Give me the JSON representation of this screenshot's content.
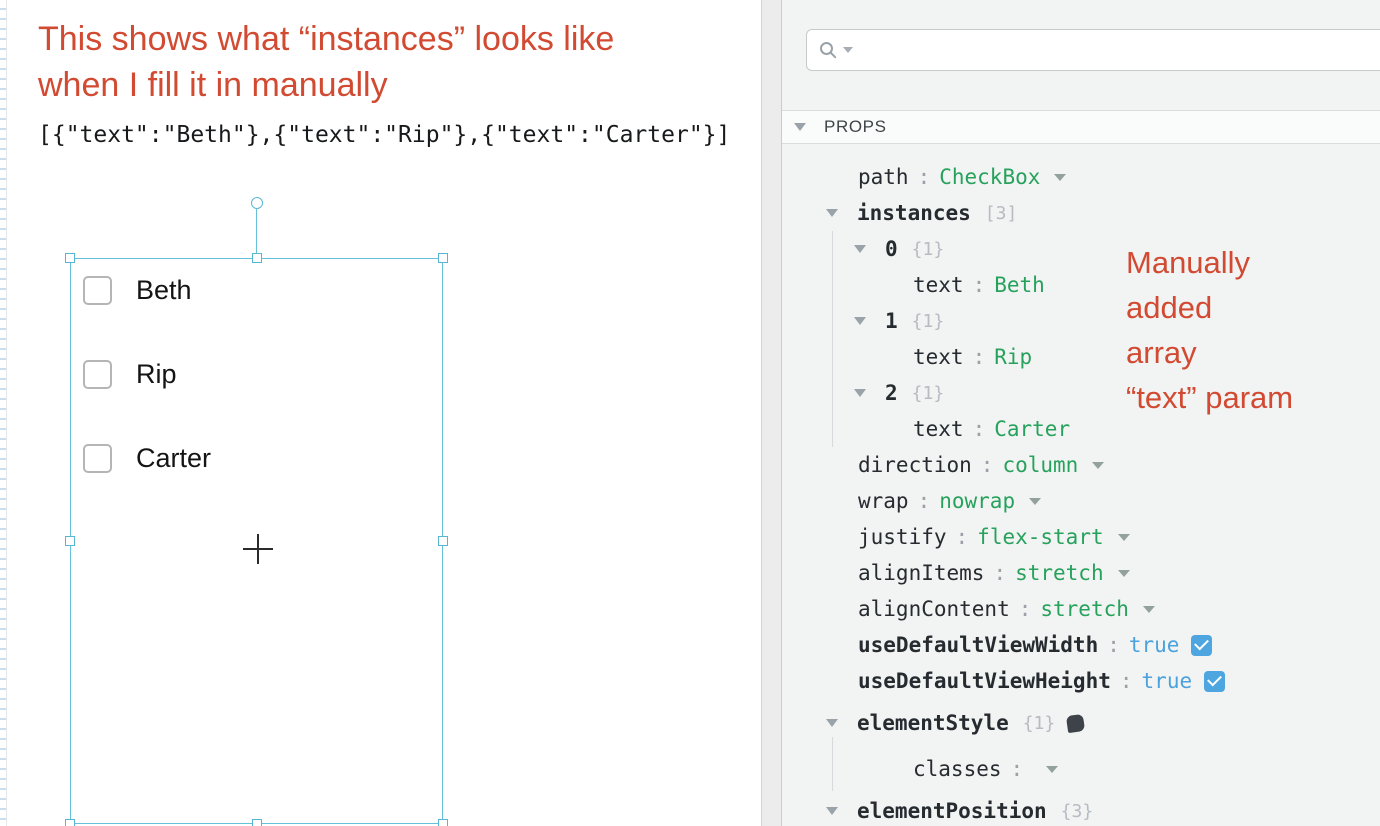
{
  "colors": {
    "annotation_red": "#d14a31",
    "value_green": "#27a25c",
    "true_blue": "#4ba2dc",
    "checkbox_blue": "#4da6df",
    "selection_blue": "#58b6d5"
  },
  "canvas": {
    "note": {
      "line1": "This shows what “instances” looks like",
      "line2": "when I fill it in manually"
    },
    "json_preview": "[{\"text\":\"Beth\"},{\"text\":\"Rip\"},{\"text\":\"Carter\"}]",
    "checkbox_labels": [
      "Beth",
      "Rip",
      "Carter"
    ]
  },
  "inspector": {
    "colon": ":",
    "section": "PROPS",
    "note": {
      "line1": "Manually",
      "line2": "added",
      "line3": "array",
      "line4": "“text” param"
    },
    "props": {
      "path": {
        "key": "path",
        "value": "CheckBox"
      },
      "instances": {
        "key": "instances",
        "badge": "[3]"
      },
      "item0": {
        "key": "0",
        "badge": "{1}"
      },
      "item0_text": {
        "key": "text",
        "value": "Beth"
      },
      "item1": {
        "key": "1",
        "badge": "{1}"
      },
      "item1_text": {
        "key": "text",
        "value": "Rip"
      },
      "item2": {
        "key": "2",
        "badge": "{1}"
      },
      "item2_text": {
        "key": "text",
        "value": "Carter"
      },
      "direction": {
        "key": "direction",
        "value": "column"
      },
      "wrap": {
        "key": "wrap",
        "value": "nowrap"
      },
      "justify": {
        "key": "justify",
        "value": "flex-start"
      },
      "alignItems": {
        "key": "alignItems",
        "value": "stretch"
      },
      "alignContent": {
        "key": "alignContent",
        "value": "stretch"
      },
      "useDefaultViewWidth": {
        "key": "useDefaultViewWidth",
        "value": "true"
      },
      "useDefaultViewHeight": {
        "key": "useDefaultViewHeight",
        "value": "true"
      },
      "elementStyle": {
        "key": "elementStyle",
        "badge": "{1}"
      },
      "classes": {
        "key": "classes"
      },
      "elementPosition": {
        "key": "elementPosition",
        "badge": "{3}"
      }
    }
  }
}
